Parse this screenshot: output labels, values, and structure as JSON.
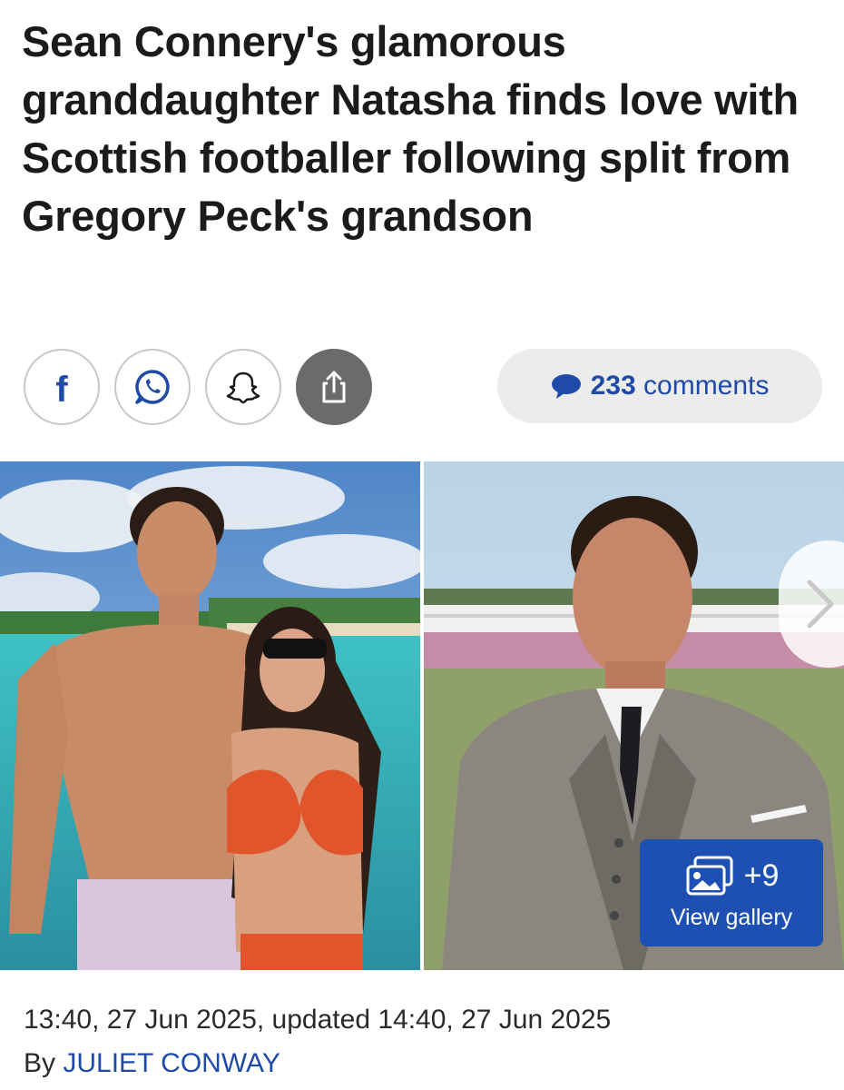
{
  "article": {
    "headline": "Sean Connery's glamorous granddaughter Natasha finds love with Scottish footballer following split from Gregory Peck's grandson",
    "timestamp": "13:40, 27 Jun 2025, updated 14:40, 27 Jun 2025",
    "byline_prefix": "By ",
    "author": "JULIET CONWAY"
  },
  "share": {
    "buttons": [
      "facebook-icon",
      "whatsapp-icon",
      "snapchat-icon",
      "share-icon"
    ],
    "comments_count": "233",
    "comments_label": "comments"
  },
  "gallery": {
    "count": "+9",
    "label": "View gallery"
  },
  "colors": {
    "accent_blue": "#1f4ba8",
    "gallery_blue": "#1e50b4",
    "pill_bg": "#ececec",
    "dark_share": "#6b6b6b"
  }
}
